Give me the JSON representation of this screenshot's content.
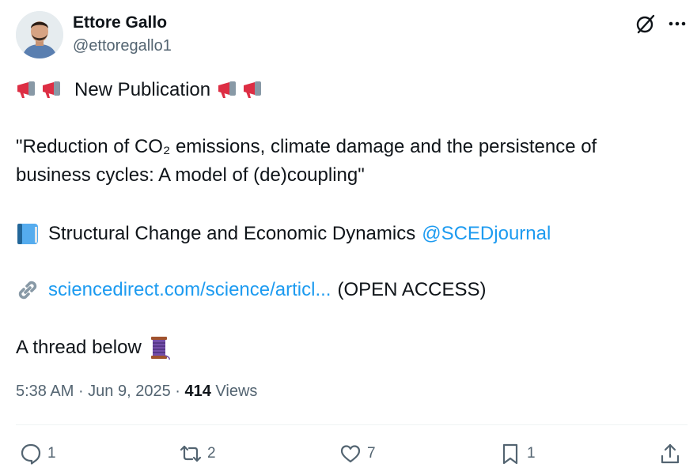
{
  "author": {
    "name": "Ettore Gallo",
    "handle": "@ettoregallo1"
  },
  "post": {
    "headline": "New Publication",
    "title_line1_pre": "\"Reduction of CO",
    "title_line1_sub": "₂",
    "title_line1_post": " emissions, climate damage and the persistence of",
    "title_line2": "business cycles: A model of (de)coupling\"",
    "journal_text": "Structural Change and Economic Dynamics",
    "journal_mention": "@SCEDjournal",
    "link_text": "sciencedirect.com/science/articl...",
    "link_suffix": "(OPEN ACCESS)",
    "thread_text": "A thread below"
  },
  "meta": {
    "time": "5:38 AM",
    "date": "Jun 9, 2025",
    "views_count": "414",
    "views_label": "Views"
  },
  "actions": {
    "replies": "1",
    "reposts": "2",
    "likes": "7",
    "bookmarks": "1"
  },
  "icons": {
    "megaphone": "megaphone-emoji",
    "book": "blue-book-emoji",
    "link": "link-emoji",
    "thread": "spool-of-thread-emoji"
  },
  "colors": {
    "link": "#1d9bf0",
    "text": "#0f1419",
    "secondary": "#536471"
  }
}
